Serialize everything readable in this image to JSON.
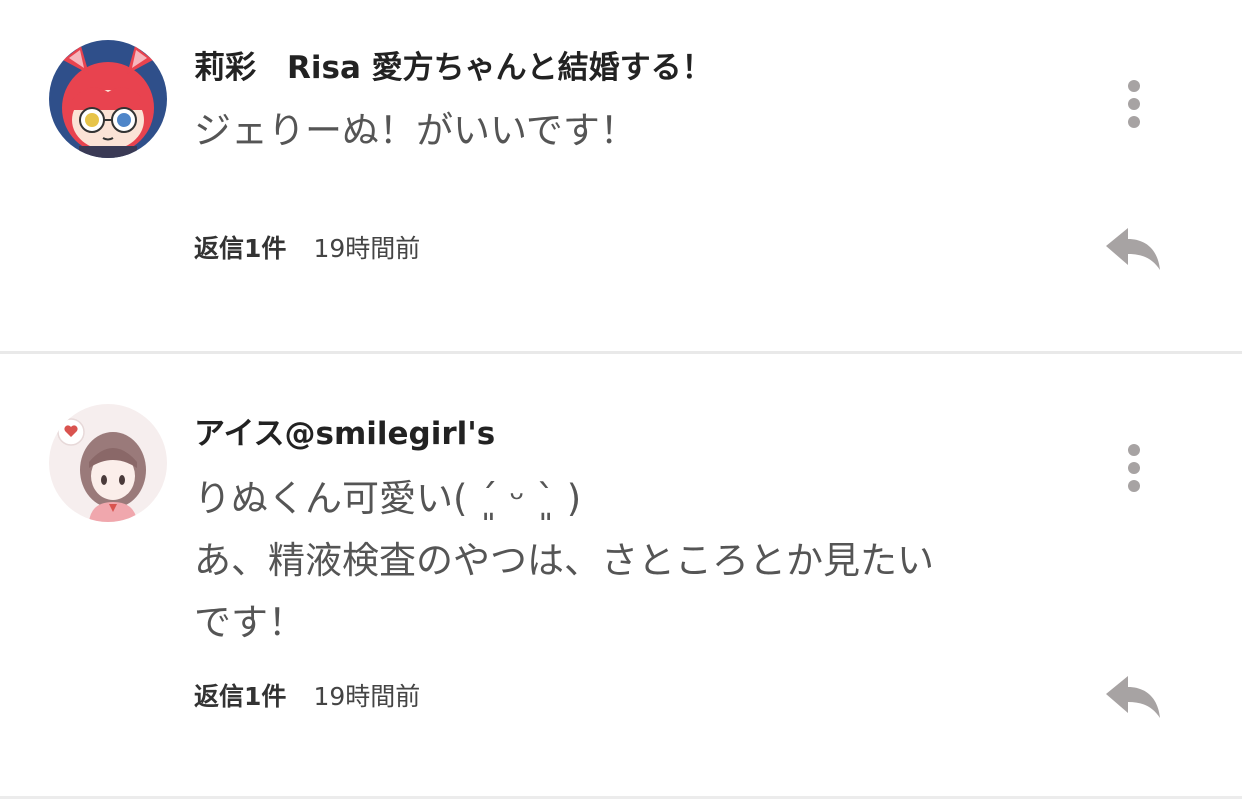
{
  "comments": [
    {
      "author": "莉彩　Risa 愛方ちゃんと結婚する！",
      "body": [
        "ジェりーぬ！がいいです！"
      ],
      "replies": "返信1件",
      "time": "19時間前"
    },
    {
      "author": "アイス@smilegirl's",
      "body": [
        "りぬくん可愛い( ´͈ ᵕ `͈ )",
        "あ、精液検査のやつは、さところとか見たい",
        "です！"
      ],
      "replies": "返信1件",
      "time": "19時間前"
    }
  ],
  "icons": {
    "more": "kebab-menu-icon",
    "reply": "reply-arrow-icon"
  },
  "colors": {
    "icon_gray": "#a7a3a3",
    "author_text": "#222222",
    "body_text": "#555555",
    "divider": "#e9e9e9"
  }
}
